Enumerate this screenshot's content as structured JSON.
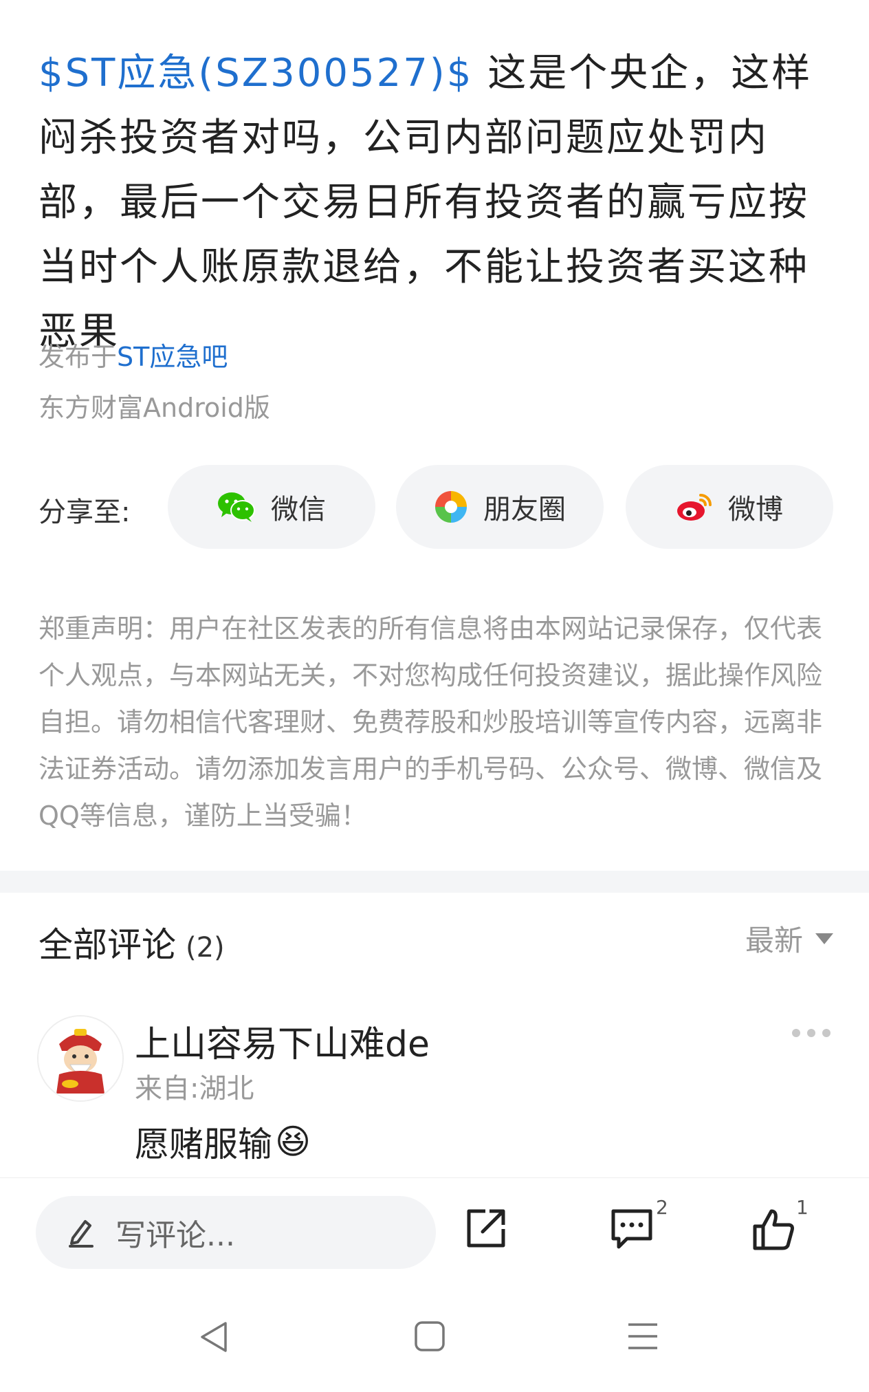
{
  "post": {
    "tag": "$ST应急(SZ300527)$",
    "body": " 这是个央企，这样闷杀投资者对吗，公司内部问题应处罚内部，最后一个交易日所有投资者的赢亏应按当时个人账原款退给，不能让投资者买这种恶果",
    "published_prefix": "发布于",
    "bar_name": "ST应急吧",
    "client": "东方财富Android版"
  },
  "share": {
    "label": "分享至:",
    "buttons": [
      {
        "label": "微信",
        "icon": "wechat-icon"
      },
      {
        "label": "朋友圈",
        "icon": "moments-icon"
      },
      {
        "label": "微博",
        "icon": "weibo-icon"
      }
    ]
  },
  "disclaimer": "郑重声明：用户在社区发表的所有信息将由本网站记录保存，仅代表个人观点，与本网站无关，不对您构成任何投资建议，据此操作风险自担。请勿相信代客理财、免费荐股和炒股培训等宣传内容，远离非法证券活动。请勿添加发言用户的手机号码、公众号、微博、微信及QQ等信息，谨防上当受骗！",
  "comments": {
    "title": "全部评论",
    "count": "(2)",
    "sort_label": "最新",
    "items": [
      {
        "user": "上山容易下山难de",
        "from": "来自:湖北",
        "text": "愿赌服输",
        "emoji": "😆"
      }
    ]
  },
  "bottom_bar": {
    "input_placeholder": "写评论...",
    "comment_count": "2",
    "like_count": "1"
  },
  "colors": {
    "link": "#1f6fce",
    "text": "#222222",
    "muted": "#999999",
    "pill_bg": "#f3f4f6"
  }
}
